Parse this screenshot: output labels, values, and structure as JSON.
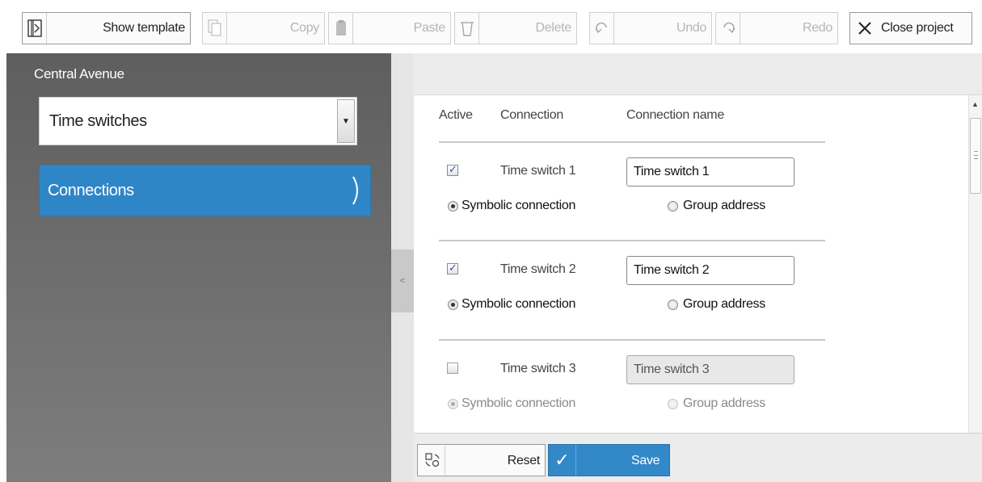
{
  "toolbar": {
    "show_template": "Show template",
    "copy": "Copy",
    "paste": "Paste",
    "delete": "Delete",
    "undo": "Undo",
    "redo": "Redo",
    "close_project": "Close project"
  },
  "sidebar": {
    "project_name": "Central Avenue",
    "category_select": "Time switches",
    "nav_item": "Connections"
  },
  "table": {
    "headers": [
      "Active",
      "Connection",
      "Connection name"
    ],
    "rows": [
      {
        "active": true,
        "connection": "Time switch 1",
        "name": "Time switch 1",
        "symbolic_label": "Symbolic connection",
        "group_label": "Group address",
        "selected": "symbolic",
        "enabled": true
      },
      {
        "active": true,
        "connection": "Time switch 2",
        "name": "Time switch 2",
        "symbolic_label": "Symbolic connection",
        "group_label": "Group address",
        "selected": "symbolic",
        "enabled": true
      },
      {
        "active": false,
        "connection": "Time switch 3",
        "name": "Time switch 3",
        "symbolic_label": "Symbolic connection",
        "group_label": "Group address",
        "selected": "symbolic",
        "enabled": false
      }
    ]
  },
  "footer": {
    "reset": "Reset",
    "save": "Save"
  },
  "colors": {
    "accent": "#3388c8",
    "sidebar_bg": "#6e6e6e"
  }
}
